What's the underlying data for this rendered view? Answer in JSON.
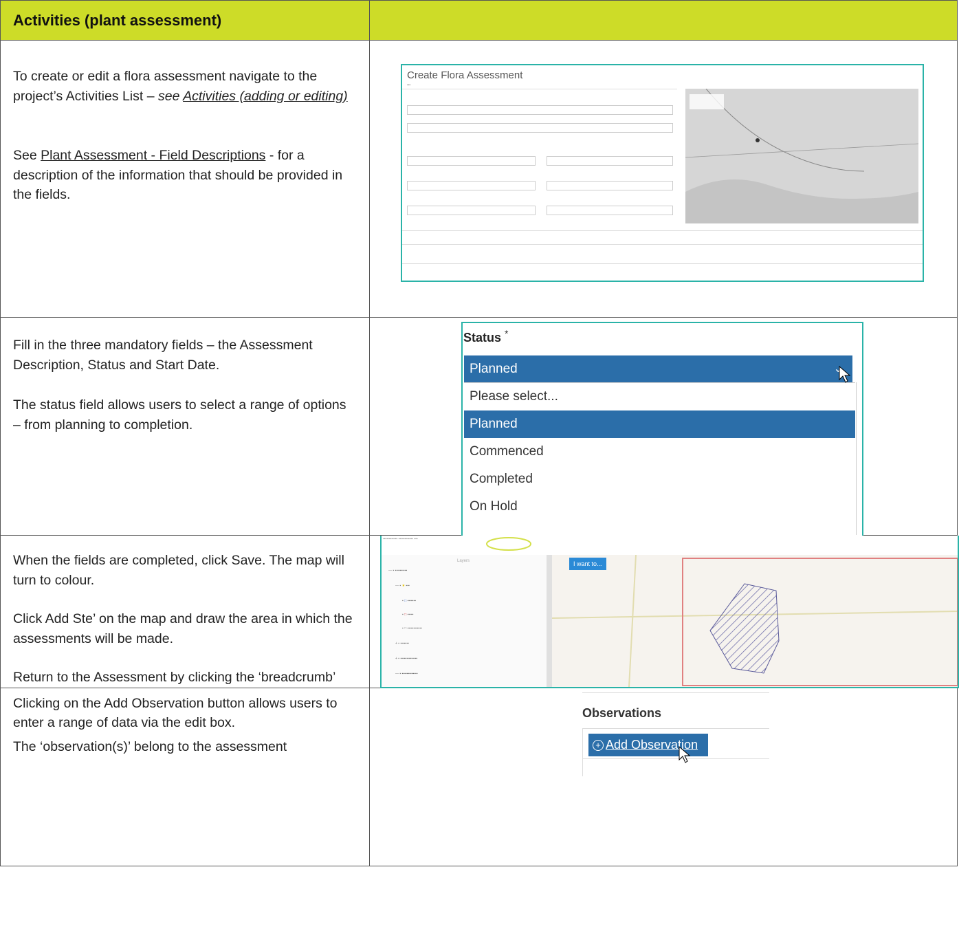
{
  "header": {
    "title": "Activities (plant assessment)"
  },
  "row1": {
    "intro_text": "To create or edit a flora assessment navigate to the project’s Activities List – ",
    "see_text": "see ",
    "link_text": "Activities (adding or editing)",
    "see_label": "See ",
    "field_link": "Plant Assessment - Field Descriptions",
    "field_text": " - for a description of the information that should be provided in the fields.",
    "screenshot": {
      "title": "Create Flora Assessment"
    }
  },
  "row2": {
    "para1": "Fill in the three mandatory fields – the Assessment Description, Status and Start Date.",
    "para2": "The status field allows users to select a range of options – from planning to completion.",
    "status_label": "Status",
    "required_mark": "*",
    "selected_value": "Planned",
    "options": [
      "Please select...",
      "Planned",
      "Commenced",
      "Completed",
      "On Hold"
    ]
  },
  "row3": {
    "para1": "When the fields are completed, click Save. The map will turn to colour.",
    "para2": "Click Add Ste’ on the map and draw the area in which the assessments will be made.",
    "para3": "Return to the Assessment by clicking the ‘breadcrumb’",
    "map": {
      "layers_title": "Layers",
      "i_want_to": "I want to..."
    }
  },
  "row4": {
    "para1": "Clicking on the Add Observation button allows users to enter a range of data via the edit box.",
    "para2": "The ‘observation(s)’ belong to the assessment",
    "observations_title": "Observations",
    "add_button": "Add Observation"
  }
}
